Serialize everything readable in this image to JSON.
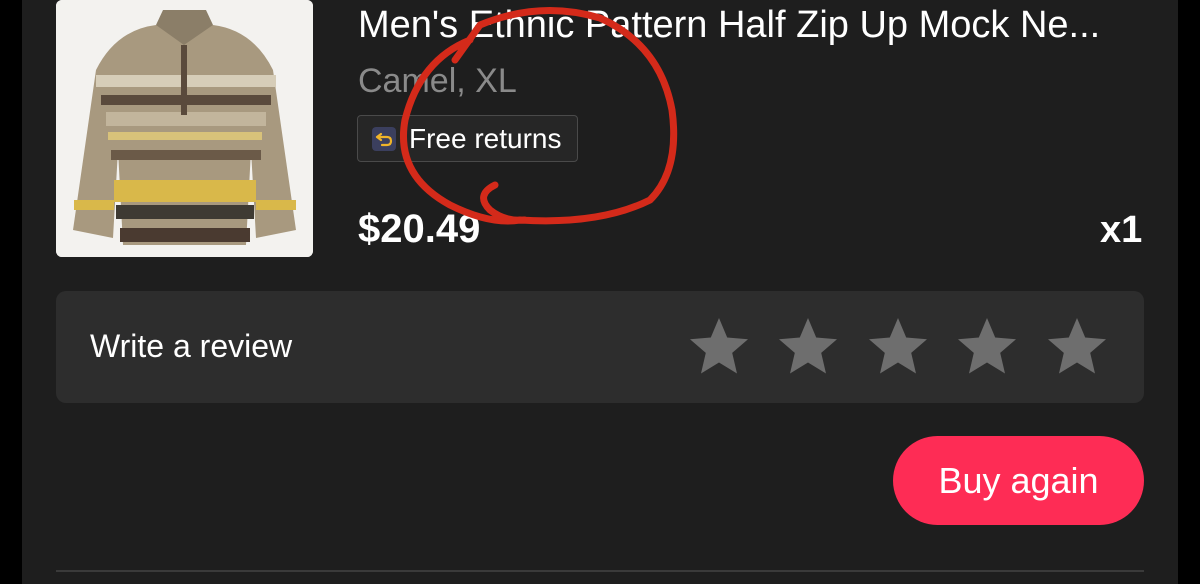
{
  "product": {
    "title": "Men's Ethnic Pattern Half Zip Up Mock Ne...",
    "variant": "Camel, XL",
    "image_icon": "sweater-product-image",
    "returns_badge": {
      "icon": "return-arrow-icon",
      "label": "Free returns"
    },
    "price": "$20.49",
    "quantity": "x1"
  },
  "review": {
    "label": "Write a review",
    "max_stars": 5,
    "rating": 0,
    "star_color": "#6e6e6e"
  },
  "actions": {
    "buy_again_label": "Buy again",
    "buy_again_color": "#fe2c55"
  },
  "colors": {
    "background": "#1e1e1e",
    "card": "#2d2d2d",
    "annotation_circle": "#d42a1a"
  }
}
